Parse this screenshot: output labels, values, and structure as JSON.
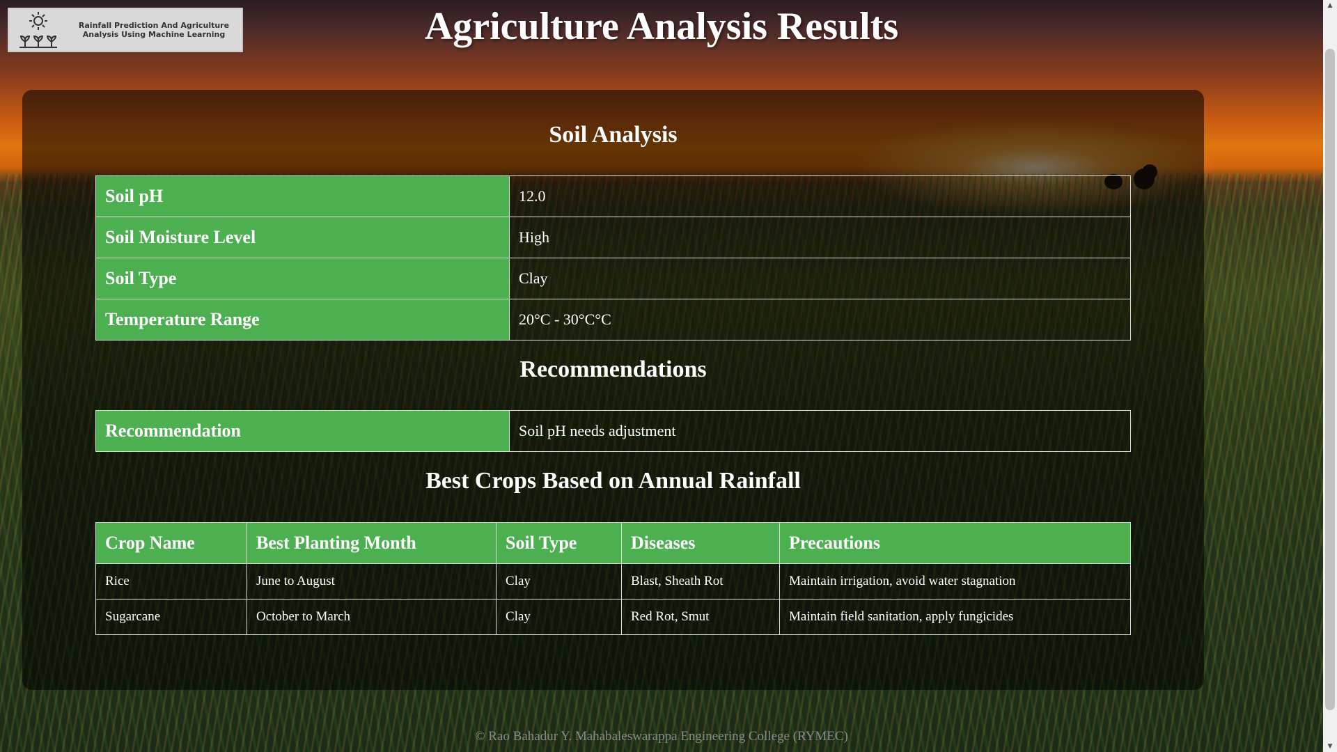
{
  "header": {
    "logo_text": "Rainfall Prediction And Agriculture Analysis Using Machine Learning",
    "title": "Agriculture Analysis Results"
  },
  "soil_analysis": {
    "heading": "Soil Analysis",
    "rows": [
      {
        "label": "Soil pH",
        "value": "12.0"
      },
      {
        "label": "Soil Moisture Level",
        "value": "High"
      },
      {
        "label": "Soil Type",
        "value": "Clay"
      },
      {
        "label": "Temperature Range",
        "value": "20°C - 30°C°C"
      }
    ]
  },
  "recommendations": {
    "heading": "Recommendations",
    "rows": [
      {
        "label": "Recommendation",
        "value": "Soil pH needs adjustment"
      }
    ]
  },
  "best_crops": {
    "heading": "Best Crops Based on Annual Rainfall",
    "columns": [
      "Crop Name",
      "Best Planting Month",
      "Soil Type",
      "Diseases",
      "Precautions"
    ],
    "rows": [
      [
        "Rice",
        "June to August",
        "Clay",
        "Blast, Sheath Rot",
        "Maintain irrigation, avoid water stagnation"
      ],
      [
        "Sugarcane",
        "October to March",
        "Clay",
        "Red Rot, Smut",
        "Maintain field sanitation, apply fungicides"
      ]
    ]
  },
  "footer": {
    "text": "© Rao Bahadur Y. Mahabaleswarappa Engineering College (RYMEC)"
  },
  "colors": {
    "table_header_green": "#4caf50",
    "panel_overlay": "rgba(0,0,0,0.55)",
    "title_text": "#ffffff",
    "footer_text": "#8a8a8a"
  },
  "icons": {
    "logo": "sun-and-plants-icon",
    "scroll_up": "scroll-up-arrow-icon",
    "scroll_down": "scroll-down-arrow-icon"
  }
}
